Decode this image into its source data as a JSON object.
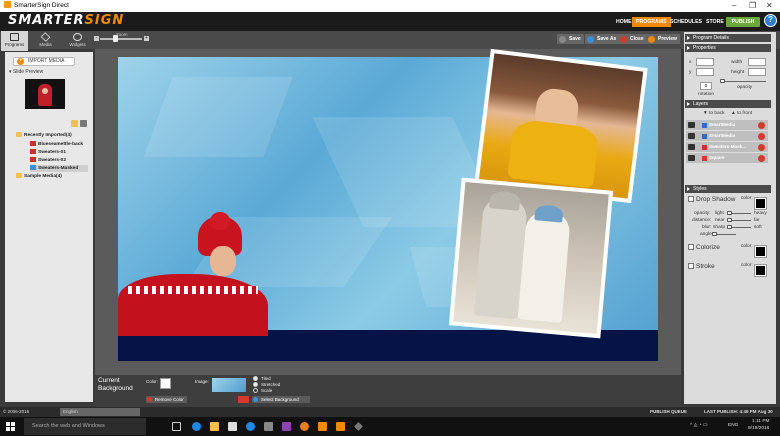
{
  "window": {
    "title": "SmarterSign Direct",
    "minimize": "–",
    "maximize": "❐",
    "close": "✕"
  },
  "logo": {
    "part1": "SMARTER",
    "part2": "SIGN"
  },
  "nav": {
    "home": "HOME",
    "programs": "PROGRAMS",
    "schedules": "SCHEDULES",
    "store": "STORE",
    "publish": "PUBLISH",
    "help": "?"
  },
  "left_tabs": [
    {
      "label": "Programs"
    },
    {
      "label": "Media"
    },
    {
      "label": "Widgets"
    }
  ],
  "zoom": {
    "label": "Zoom",
    "minus": "-",
    "plus": "+",
    "level": 0.35
  },
  "toolbar": {
    "save": "Save",
    "save_as": "Save As",
    "close": "Close",
    "preview": "Preview",
    "accent": "#f18a00"
  },
  "media": {
    "import_button": "IMPORT MEDIA",
    "slide_preview": "Slide Preview",
    "tree": [
      {
        "label": "Recently Imported(4)",
        "icon": "folder-icon"
      },
      {
        "label": "Blueseamettle-back",
        "icon": "file-icon"
      },
      {
        "label": "Sweaters-01",
        "icon": "file-icon"
      },
      {
        "label": "Sweaters-02",
        "icon": "file-icon"
      },
      {
        "label": "Sweaters-Masked",
        "icon": "file-icon"
      },
      {
        "label": "Sample Media(4)",
        "icon": "folder-icon"
      }
    ]
  },
  "background": {
    "title_line1": "Current",
    "title_line2": "Background",
    "color_label": "Color:",
    "image_label": "Image:",
    "remove_color": "Remove Color",
    "select_background": "Select Background",
    "options": [
      {
        "label": "Tiled",
        "selected": true
      },
      {
        "label": "Stretched",
        "selected": true
      },
      {
        "label": "Scale",
        "selected": false
      }
    ]
  },
  "right": {
    "program_details": "Program Details",
    "properties": "Properties",
    "x_label": "x",
    "y_label": "y",
    "width_label": "width",
    "height_label": "height",
    "rotation_label": "rotation",
    "opacity_label": "opacity",
    "rotation_value": "0",
    "layers": "Layers",
    "to_back": "to back",
    "to_front": "to front",
    "layer_items": [
      {
        "label": "SmartMedia"
      },
      {
        "label": "SmartMedia"
      },
      {
        "label": "Sweaters-Mask..."
      },
      {
        "label": "Square"
      }
    ],
    "styles": "Styles",
    "drop_shadow": "Drop Shadow",
    "colorize": "Colorize",
    "stroke": "Stroke",
    "color_label": "color:",
    "opacity_row": {
      "label": "opacity:",
      "left": "light",
      "right": "heavy"
    },
    "distance_row": {
      "label": "distance:",
      "left": "near",
      "right": "far"
    },
    "blur_row": {
      "label": "blur:",
      "left": "sharp",
      "right": "soft"
    },
    "angle_row": {
      "label": "angle:"
    }
  },
  "status": {
    "copyright": "© 2006-2016",
    "language": "English",
    "publish_queue": "PUBLISH QUEUE",
    "last_publish": "LAST PUBLISH: 4:49 PM Aug 30"
  },
  "taskbar": {
    "search": "Search the web and Windows",
    "time": "1:11 PM",
    "date": "9/19/2016",
    "lang": "ENG"
  }
}
